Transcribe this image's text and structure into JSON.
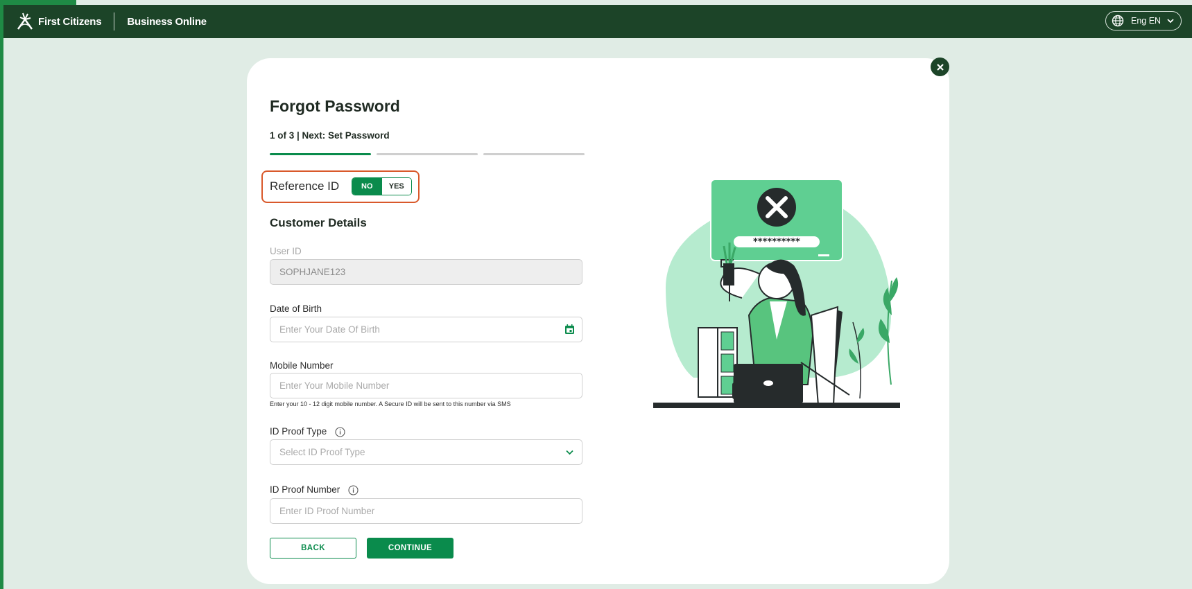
{
  "header": {
    "brand": "First Citizens",
    "product": "Business Online",
    "language": "Eng EN"
  },
  "form": {
    "title": "Forgot Password",
    "step_text": "1 of 3 | Next: Set Password",
    "steps": [
      {
        "state": "active"
      },
      {
        "state": "pending"
      },
      {
        "state": "pending"
      }
    ],
    "reference_id": {
      "label": "Reference ID",
      "options": [
        "NO",
        "YES"
      ],
      "selected": "NO"
    },
    "section_title": "Customer Details",
    "user_id": {
      "label": "User ID",
      "value": "SOPHJANE123"
    },
    "dob": {
      "label": "Date of Birth",
      "placeholder": "Enter Your Date Of Birth"
    },
    "mobile": {
      "label": "Mobile Number",
      "placeholder": "Enter Your Mobile Number",
      "hint": "Enter your 10 - 12 digit mobile number. A Secure ID will be sent to this number via SMS"
    },
    "id_proof_type": {
      "label": "ID Proof Type",
      "placeholder": "Select ID Proof Type"
    },
    "id_proof_number": {
      "label": "ID Proof Number",
      "placeholder": "Enter ID Proof Number"
    },
    "buttons": {
      "back": "BACK",
      "continue": "CONTINUE"
    }
  },
  "illustration": {
    "masked_password": "**********"
  },
  "icons": {
    "logo": "first-citizens-logo-icon",
    "globe": "globe-icon",
    "chevron": "chevron-down-icon",
    "close": "close-icon",
    "calendar": "calendar-icon",
    "info": "info-icon"
  },
  "colors": {
    "header_bg": "#1c4428",
    "accent": "#0a8b4c",
    "page_bg": "#e0ece5",
    "highlight": "#d9592b"
  }
}
